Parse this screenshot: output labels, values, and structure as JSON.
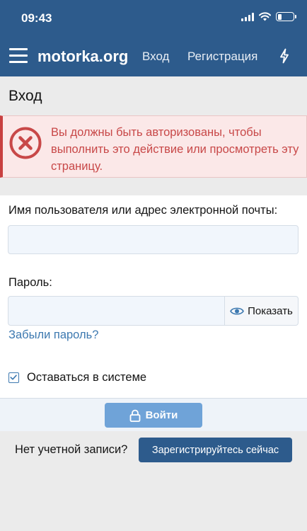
{
  "status": {
    "time": "09:43",
    "battery_level": 0.25
  },
  "header": {
    "brand": "motorka.org",
    "login_link": "Вход",
    "register_link": "Регистрация",
    "icons": [
      "menu-icon",
      "bolt-icon"
    ]
  },
  "page": {
    "title": "Вход"
  },
  "alert": {
    "text": "Вы должны быть авторизованы, чтобы выполнить это действие или просмотреть эту страницу.",
    "icon": "error-x-icon",
    "color": "#c84848"
  },
  "form": {
    "username_label": "Имя пользователя или адрес электронной почты:",
    "username_value": "",
    "password_label": "Пароль:",
    "password_value": "",
    "show_password_label": "Показать",
    "forgot_password": "Забыли пароль?",
    "remember_label": "Оставаться в системе",
    "remember_checked": true,
    "login_button": "Войти"
  },
  "register": {
    "prompt": "Нет учетной записи?",
    "button": "Зарегистрируйтесь сейчас"
  },
  "colors": {
    "brand": "#2d5b8c",
    "link": "#3d79b0",
    "login_button": "#6fa3d8"
  }
}
